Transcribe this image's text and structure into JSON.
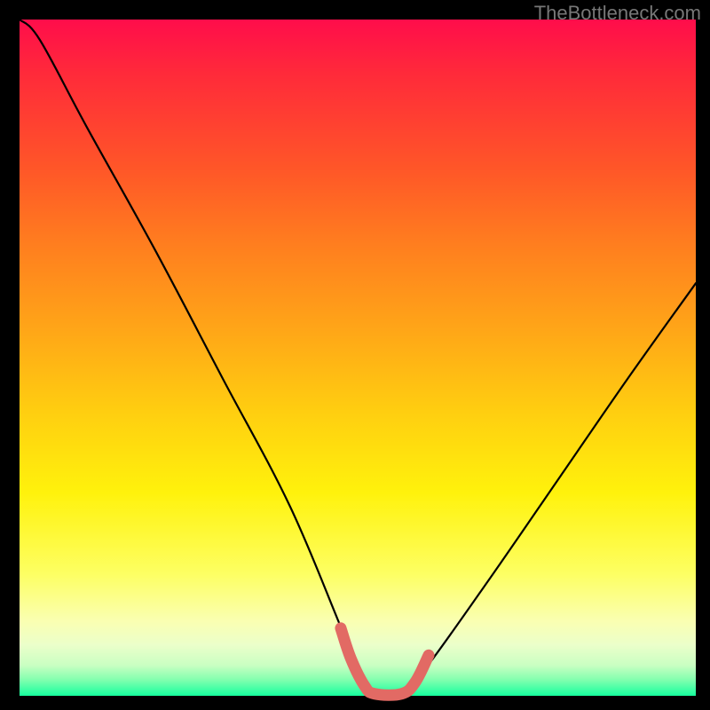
{
  "watermark": "TheBottleneck.com",
  "chart_data": {
    "type": "line",
    "title": "",
    "xlabel": "",
    "ylabel": "",
    "xlim": [
      0,
      100
    ],
    "ylim": [
      0,
      100
    ],
    "series": [
      {
        "name": "bottleneck-curve",
        "x": [
          0,
          3,
          10,
          20,
          30,
          40,
          48,
          52,
          56,
          60,
          70,
          80,
          90,
          100
        ],
        "values": [
          100,
          97,
          84,
          66,
          47,
          28,
          9,
          0,
          0,
          4,
          18,
          32.5,
          47,
          61
        ]
      }
    ],
    "highlight_segment": {
      "name": "optimal-range",
      "x": [
        47.5,
        49,
        51,
        52.5,
        56.5,
        58.5,
        60.5
      ],
      "values": [
        10,
        5.5,
        1.5,
        0.3,
        0.3,
        2,
        6
      ],
      "color": "#e26a64",
      "width_relative": 1.4
    },
    "gradient_stops": [
      {
        "pos": 0.0,
        "color": "#ff0d4b"
      },
      {
        "pos": 0.08,
        "color": "#ff2a3a"
      },
      {
        "pos": 0.22,
        "color": "#ff5628"
      },
      {
        "pos": 0.33,
        "color": "#ff7d1f"
      },
      {
        "pos": 0.45,
        "color": "#ffa318"
      },
      {
        "pos": 0.58,
        "color": "#ffce10"
      },
      {
        "pos": 0.7,
        "color": "#fff20c"
      },
      {
        "pos": 0.82,
        "color": "#fdff63"
      },
      {
        "pos": 0.89,
        "color": "#faffb2"
      },
      {
        "pos": 0.925,
        "color": "#ebffca"
      },
      {
        "pos": 0.955,
        "color": "#c9ffc2"
      },
      {
        "pos": 0.975,
        "color": "#87ffb0"
      },
      {
        "pos": 1.0,
        "color": "#16ff9e"
      }
    ]
  }
}
